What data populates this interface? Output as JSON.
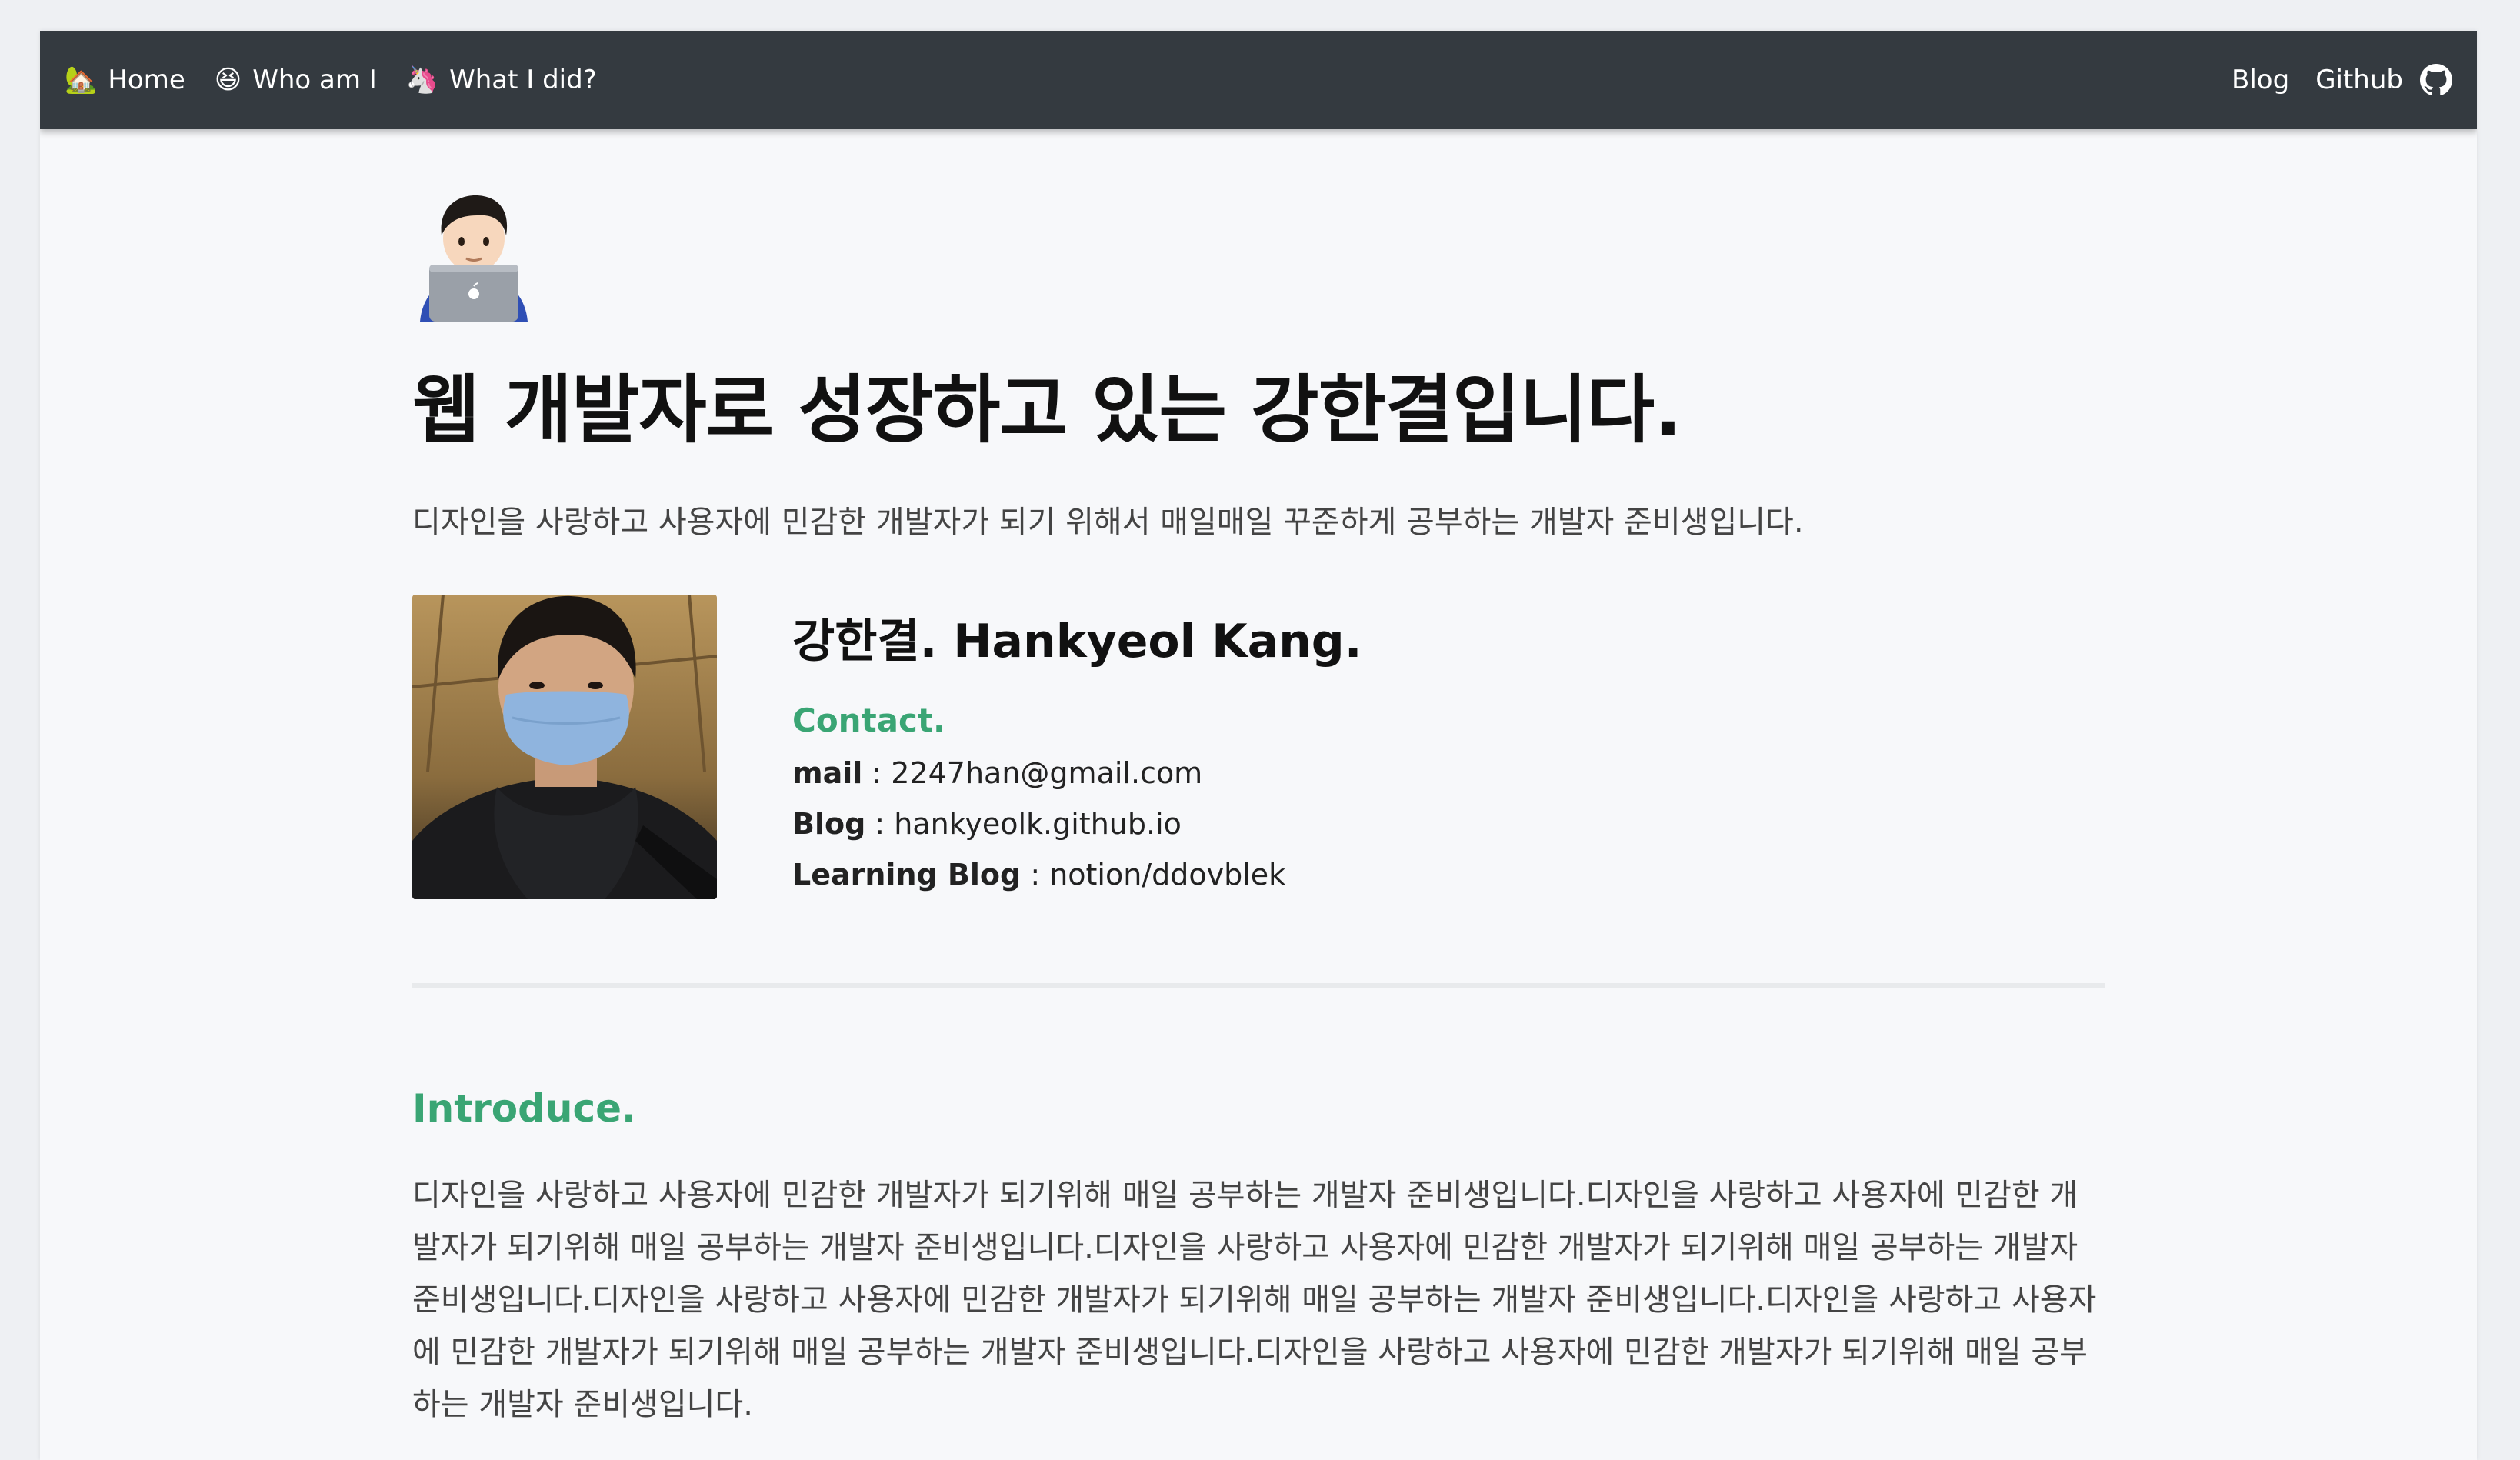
{
  "nav": {
    "left_items": [
      {
        "icon": "house-with-garden-emoji",
        "glyph": "🏡",
        "label": "Home"
      },
      {
        "icon": "grinning-squinting-face-emoji",
        "glyph": "😆",
        "label": "Who am I"
      },
      {
        "icon": "unicorn-emoji",
        "glyph": "🦄",
        "label": "What I did?"
      }
    ],
    "right_items": [
      {
        "label": "Blog"
      },
      {
        "label": "Github"
      }
    ],
    "github_icon": "github-icon"
  },
  "hero": {
    "emoji_icon": "technologist-laptop-emoji",
    "title": "웹 개발자로 성장하고 있는 강한결입니다.",
    "subtitle": "디자인을 사랑하고 사용자에 민감한 개발자가 되기 위해서 매일매일 꾸준하게 공부하는 개발자 준비생입니다."
  },
  "profile": {
    "photo_icon": "profile-photo",
    "name": "강한결. Hankyeol Kang.",
    "contact_title": "Contact.",
    "contacts": [
      {
        "key": "mail",
        "sep": " : ",
        "value": "2247han@gmail.com"
      },
      {
        "key": "Blog",
        "sep": " : ",
        "value": "hankyeolk.github.io"
      },
      {
        "key": "Learning Blog",
        "sep": " : ",
        "value": "notion/ddovblek"
      }
    ]
  },
  "introduce": {
    "title": "Introduce.",
    "body": "디자인을 사랑하고 사용자에 민감한 개발자가 되기위해 매일 공부하는 개발자 준비생입니다.디자인을 사랑하고 사용자에 민감한 개발자가 되기위해 매일 공부하는 개발자 준비생입니다.디자인을 사랑하고 사용자에 민감한 개발자가 되기위해 매일 공부하는 개발자 준비생입니다.디자인을 사랑하고 사용자에 민감한 개발자가 되기위해 매일 공부하는 개발자 준비생입니다.디자인을 사랑하고 사용자에 민감한 개발자가 되기위해 매일 공부하는 개발자 준비생입니다.디자인을 사랑하고 사용자에 민감한 개발자가 되기위해 매일 공부하는 개발자 준비생입니다."
  },
  "colors": {
    "navbar_bg": "#343a40",
    "accent_green": "#3aa574",
    "page_bg": "#f7f8fa"
  }
}
